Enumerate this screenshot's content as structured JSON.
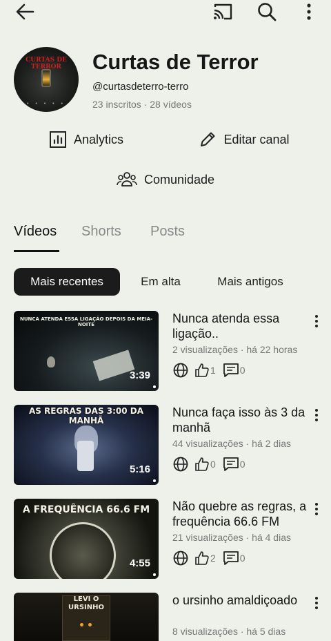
{
  "topbar": {
    "back_icon": "arrow-left-icon",
    "cast_icon": "cast-icon",
    "search_icon": "search-icon",
    "more_icon": "more-vertical-icon"
  },
  "channel": {
    "avatar_text": "CURTAS DE TERROR",
    "name": "Curtas de Terror",
    "handle": "@curtasdeterro-terro",
    "stats": "23 inscritos · 28 vídeos"
  },
  "actions": {
    "analytics_label": "Analytics",
    "edit_label": "Editar canal",
    "community_label": "Comunidade"
  },
  "tabs": [
    {
      "label": "Vídeos",
      "active": true
    },
    {
      "label": "Shorts",
      "active": false
    },
    {
      "label": "Posts",
      "active": false
    }
  ],
  "filters": [
    {
      "label": "Mais recentes",
      "active": true
    },
    {
      "label": "Em alta",
      "active": false
    },
    {
      "label": "Mais antigos",
      "active": false
    }
  ],
  "videos": [
    {
      "thumb_text": "NUNCA ATENDA ESSA LIGAÇÃO DEPOIS DA MEIA-NOITE",
      "duration": "3:39",
      "title": "Nunca atenda essa ligação..",
      "meta": "2 visualizações · há 22 horas",
      "likes": "1",
      "comments": "0"
    },
    {
      "thumb_text": "AS REGRAS DAS 3:00 DA MANHÃ",
      "duration": "5:16",
      "title": "Nunca faça isso às 3 da manhã",
      "meta": "44 visualizações · há 2 dias",
      "likes": "0",
      "comments": "0"
    },
    {
      "thumb_text": "A FREQUÊNCIA 66.6 FM",
      "duration": "4:55",
      "title": "Não quebre as regras, a frequência 66.6 FM",
      "meta": "21 visualizações · há 4 dias",
      "likes": "2",
      "comments": "0"
    },
    {
      "thumb_text": "LEVI O URSINHO",
      "duration": "",
      "title": "o ursinho amaldiçoado",
      "meta": "8 visualizações · há 5 dias",
      "likes": "",
      "comments": ""
    }
  ],
  "colors": {
    "background": "#eef1ea",
    "chip_active": "#1b1b1b",
    "avatar_accent": "#c92020"
  }
}
